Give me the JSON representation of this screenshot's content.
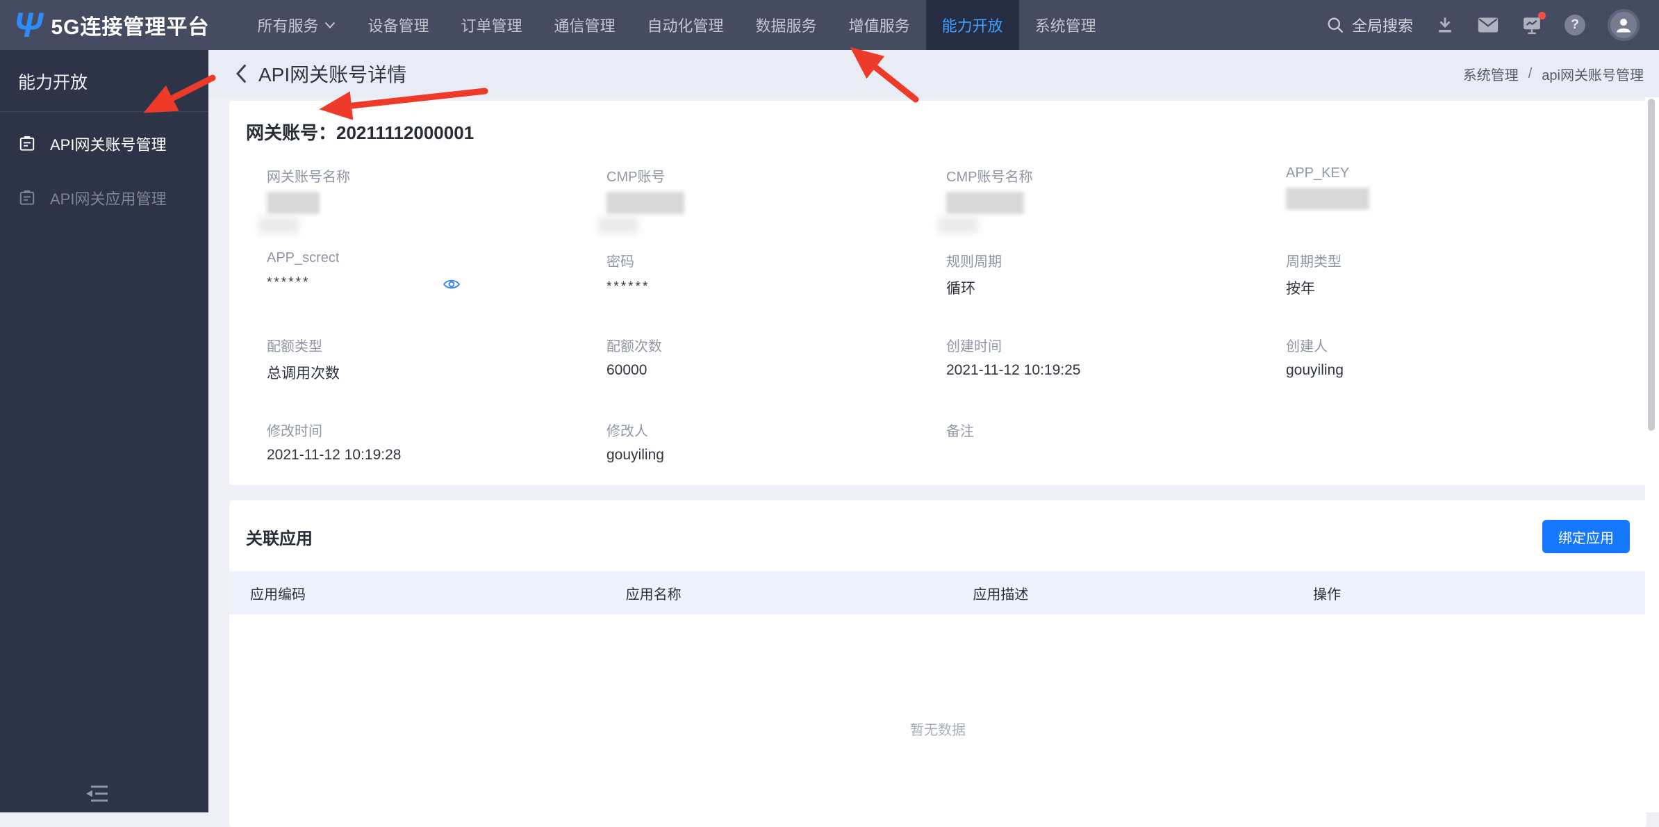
{
  "navbar": {
    "brand": "5G连接管理平台",
    "items": [
      {
        "label": "所有服务",
        "dropdown": true
      },
      {
        "label": "设备管理"
      },
      {
        "label": "订单管理"
      },
      {
        "label": "通信管理"
      },
      {
        "label": "自动化管理"
      },
      {
        "label": "数据服务"
      },
      {
        "label": "增值服务"
      },
      {
        "label": "能力开放",
        "active": true
      },
      {
        "label": "系统管理"
      }
    ],
    "search_label": "全局搜索",
    "help_glyph": "?"
  },
  "sidebar": {
    "title": "能力开放",
    "items": [
      {
        "label": "API网关账号管理",
        "active": true
      },
      {
        "label": "API网关应用管理",
        "active": false
      }
    ]
  },
  "page_header": {
    "title": "API网关账号详情",
    "breadcrumb": {
      "parent": "系统管理",
      "separator": "/",
      "current": "api网关账号管理"
    }
  },
  "detail": {
    "account_label": "网关账号：",
    "account_value": "20211112000001",
    "fields": [
      {
        "label": "网关账号名称",
        "value": "",
        "redacted": true
      },
      {
        "label": "CMP账号",
        "value": "",
        "redacted": true
      },
      {
        "label": "CMP账号名称",
        "value": "",
        "redacted": true
      },
      {
        "label": "APP_KEY",
        "value": "",
        "redacted": true
      },
      {
        "label": "APP_screct",
        "value": "******",
        "has_eye_icon": true
      },
      {
        "label": "密码",
        "value": "******"
      },
      {
        "label": "规则周期",
        "value": "循环"
      },
      {
        "label": "周期类型",
        "value": "按年"
      },
      {
        "label": "配额类型",
        "value": "总调用次数"
      },
      {
        "label": "配额次数",
        "value": "60000"
      },
      {
        "label": "创建时间",
        "value": "2021-11-12 10:19:25"
      },
      {
        "label": "创建人",
        "value": "gouyiling"
      },
      {
        "label": "修改时间",
        "value": "2021-11-12 10:19:28"
      },
      {
        "label": "修改人",
        "value": "gouyiling"
      },
      {
        "label": "备注",
        "value": ""
      },
      {
        "label": "",
        "value": ""
      }
    ]
  },
  "related": {
    "title": "关联应用",
    "bind_button": "绑定应用",
    "columns": [
      "应用编码",
      "应用名称",
      "应用描述",
      "操作"
    ],
    "rows": [],
    "empty_text": "暂无数据"
  },
  "colors": {
    "accent_blue": "#1677ff",
    "nav_active_text": "#3fa1ff",
    "navbar_bg": "#454b61",
    "sidebar_bg": "#2e3447",
    "table_header_bg": "#eef2fb",
    "annotation_arrow": "#ee3a28"
  }
}
